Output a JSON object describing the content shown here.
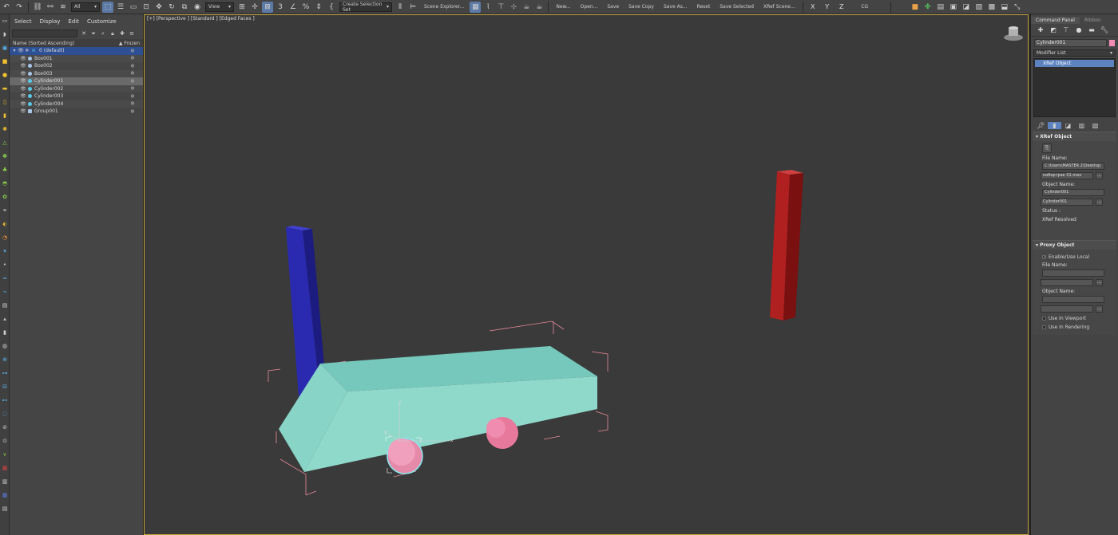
{
  "toolbar": {
    "selection_filter": "All",
    "ref_coord": "View",
    "named_selection": "Create Selection Set",
    "scene_explorer": "Scene Explorer...",
    "file_buttons": [
      "New...",
      "Open...",
      "Save",
      "Save Copy",
      "Save As...",
      "Reset",
      "Save Selected",
      "XRef Scene..."
    ],
    "axes": [
      "X",
      "Y",
      "Z"
    ],
    "cg_label": "CG"
  },
  "explorer": {
    "menu": [
      "Select",
      "Display",
      "Edit",
      "Customize"
    ],
    "col_name": "Name (Sorted Ascending)",
    "col_frozen": "▲ Frozen",
    "layer": "0 (default)",
    "items": [
      {
        "name": "Box001",
        "color": "#a9c7e8"
      },
      {
        "name": "Box002",
        "color": "#a9c7e8"
      },
      {
        "name": "Box003",
        "color": "#a9c7e8"
      },
      {
        "name": "Cylinder001",
        "color": "#a9c7e8"
      },
      {
        "name": "Cylinder002",
        "color": "#a9c7e8"
      },
      {
        "name": "Cylinder003",
        "color": "#a9c7e8"
      },
      {
        "name": "Cylinder004",
        "color": "#a9c7e8"
      },
      {
        "name": "Group001",
        "color": "#a9c7e8"
      }
    ]
  },
  "viewport": {
    "label": "[+] [Perspective ] [Standard ] [Edged Faces ]",
    "axis_labels": {
      "x": "x",
      "y": "y",
      "z": "z"
    }
  },
  "command_panel": {
    "tabs": [
      "Command Panel",
      "Ribbon"
    ],
    "object_name": "Cylinder001",
    "object_color": "#f28cb2",
    "modifier_list": "Modifier List",
    "stack_item": "XRef Object",
    "xref": {
      "title": "XRef Object",
      "file_name_label": "File Name:",
      "file_path": "C:\\Users\\MASTER 2\\Desktop",
      "file_value": "кибертрак 01.max",
      "object_name_label": "Object Name:",
      "object_name_value": "Cylinder001",
      "object_field": "Cylinder001",
      "status_label": "Status :",
      "status_value": "XRef Resolved"
    },
    "proxy": {
      "title": "Proxy Object",
      "enable_label": "Enable/Use Local",
      "file_name_label": "File Name:",
      "object_name_label": "Object Name:",
      "use_viewport": "Use In Viewport",
      "use_rendering": "Use In Rendering"
    }
  }
}
